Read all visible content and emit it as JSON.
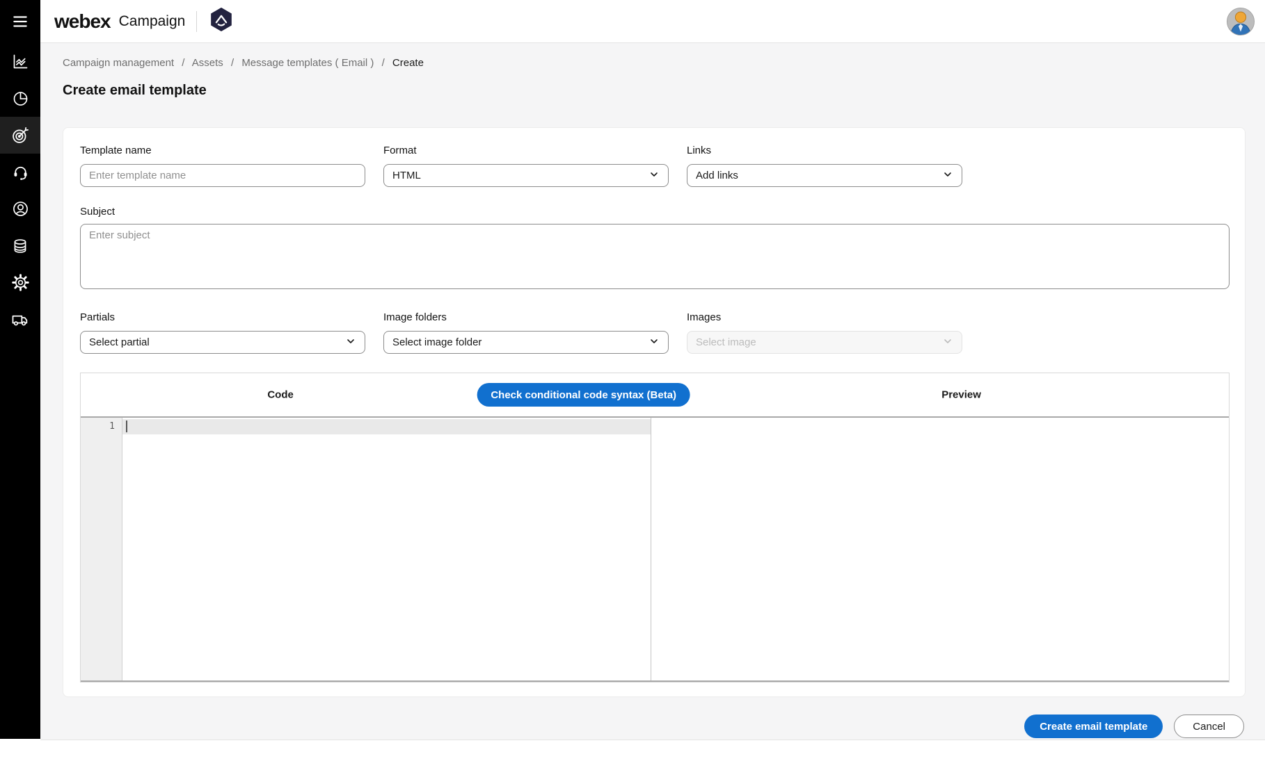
{
  "colors": {
    "accent": "#1170CF",
    "sidebar_bg": "#000000",
    "page_bg": "#f5f5f6",
    "badge_bg": "#22223f"
  },
  "header": {
    "brand": "webex",
    "product": "Campaign"
  },
  "sidebar": {
    "items": [
      {
        "icon": "hamburger-icon"
      },
      {
        "icon": "line-chart-icon"
      },
      {
        "icon": "pie-chart-icon"
      },
      {
        "icon": "target-icon",
        "active": true
      },
      {
        "icon": "headset-icon"
      },
      {
        "icon": "user-icon"
      },
      {
        "icon": "database-icon"
      },
      {
        "icon": "gear-icon"
      },
      {
        "icon": "truck-icon"
      }
    ]
  },
  "breadcrumb": {
    "separator": "/",
    "items": [
      "Campaign management",
      "Assets",
      "Message templates ( Email )",
      "Create"
    ]
  },
  "page": {
    "title": "Create email template"
  },
  "form": {
    "template_name": {
      "label": "Template name",
      "placeholder": "Enter template name",
      "value": ""
    },
    "format": {
      "label": "Format",
      "value": "HTML"
    },
    "links": {
      "label": "Links",
      "value": "Add links"
    },
    "subject": {
      "label": "Subject",
      "placeholder": "Enter subject",
      "value": ""
    },
    "partials": {
      "label": "Partials",
      "value": "Select partial"
    },
    "image_folders": {
      "label": "Image folders",
      "value": "Select image folder"
    },
    "images": {
      "label": "Images",
      "value": "Select image",
      "disabled": true
    }
  },
  "code_section": {
    "code_header": "Code",
    "check_button": "Check conditional code syntax (Beta)",
    "preview_header": "Preview",
    "line_numbers": [
      "1"
    ]
  },
  "actions": {
    "create": "Create email template",
    "cancel": "Cancel"
  }
}
